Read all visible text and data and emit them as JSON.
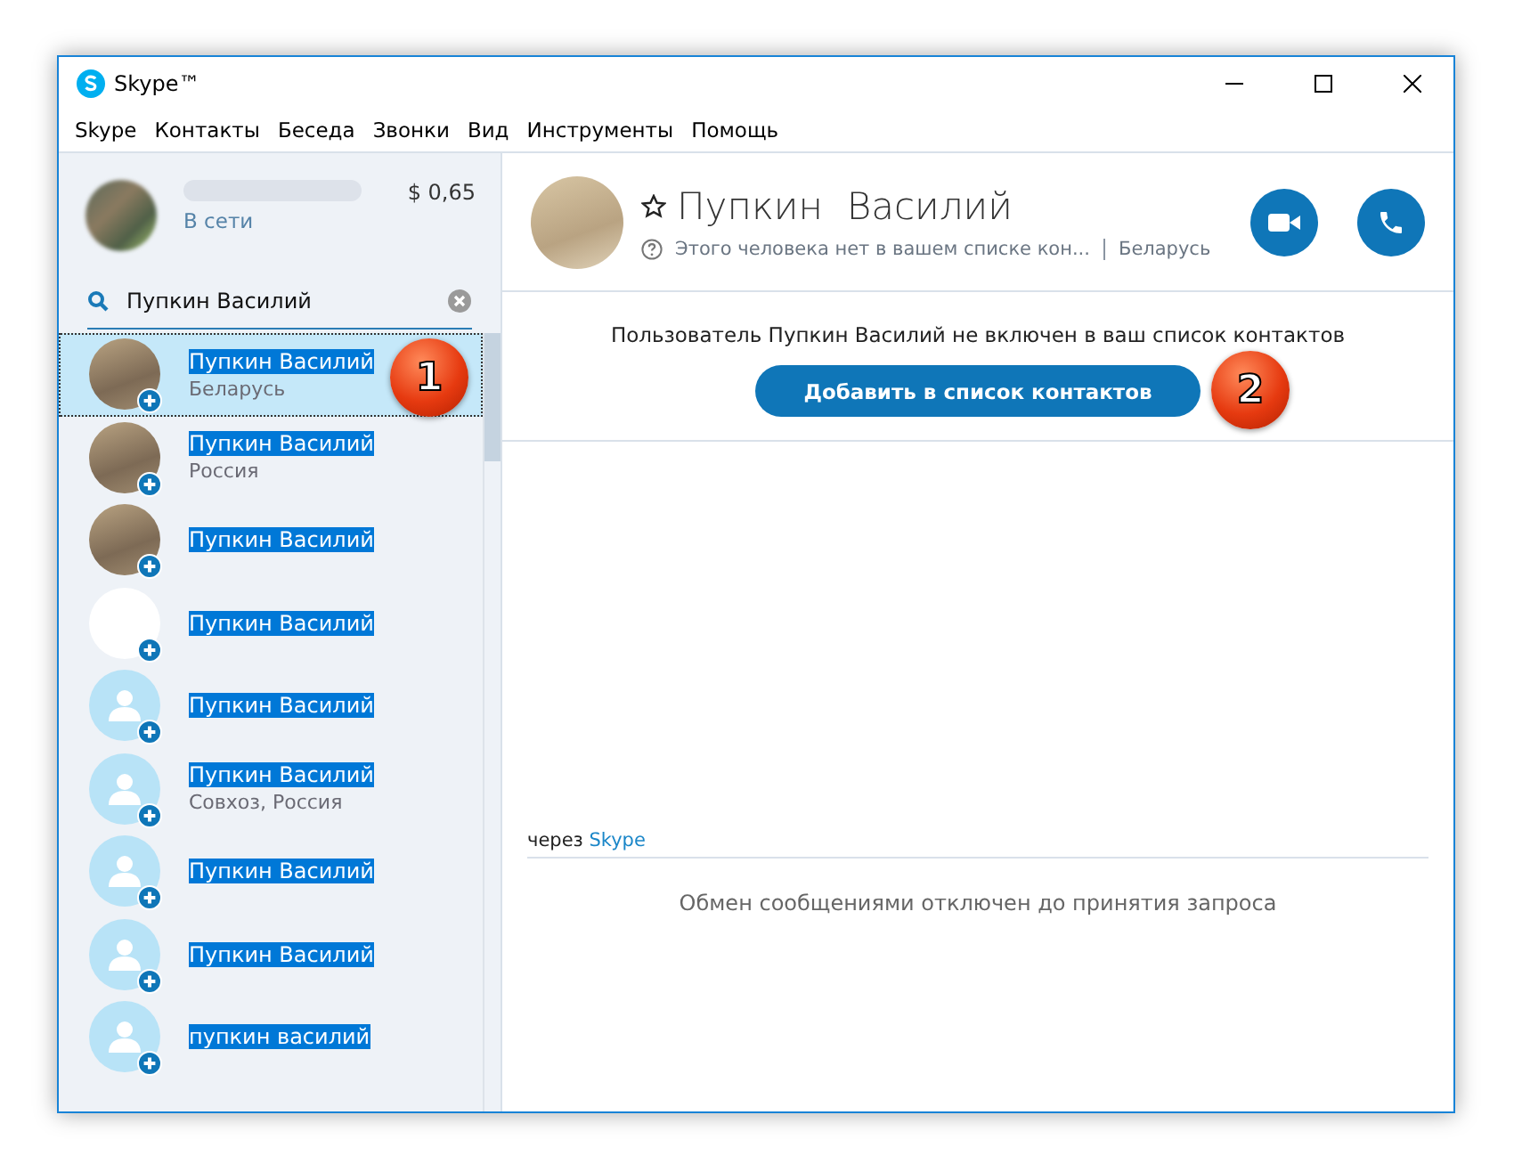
{
  "window": {
    "title": "Skype™"
  },
  "menu": [
    "Skype",
    "Контакты",
    "Беседа",
    "Звонки",
    "Вид",
    "Инструменты",
    "Помощь"
  ],
  "profile": {
    "status": "В сети",
    "balance": "$ 0,65"
  },
  "search": {
    "value": "Пупкин Василий"
  },
  "contacts": [
    {
      "name": "Пупкин  Василий",
      "location": "Беларусь",
      "kind": "photo",
      "selected": true,
      "marker": "1"
    },
    {
      "name": "Пупкин Василий",
      "location": "Россия",
      "kind": "photo",
      "selected": false
    },
    {
      "name": "Пупкин Василий",
      "kind": "photo",
      "selected": false
    },
    {
      "name": "Пупкин Василий",
      "kind": "blank",
      "selected": false
    },
    {
      "name": "Пупкин Василий",
      "kind": "default",
      "selected": false
    },
    {
      "name": "Пупкин Василий",
      "location": "Совхоз, Россия",
      "kind": "default",
      "selected": false
    },
    {
      "name": "Пупкин Василий",
      "kind": "default",
      "selected": false
    },
    {
      "name": "Пупкин Василий",
      "kind": "default",
      "selected": false
    },
    {
      "name": "пупкин василий",
      "kind": "default",
      "selected": false
    }
  ],
  "conversation": {
    "name": "Пупкин  Василий",
    "note": "Этого человека нет в вашем списке кон...",
    "country": "Беларусь",
    "notice": "Пользователь Пупкин  Василий не включен в ваш список контактов",
    "add_button": {
      "label": "Добавить в список контактов",
      "marker": "2"
    },
    "via": "через",
    "via_link": "Skype",
    "disabled_message": "Обмен сообщениями отключен до принятия запроса"
  }
}
